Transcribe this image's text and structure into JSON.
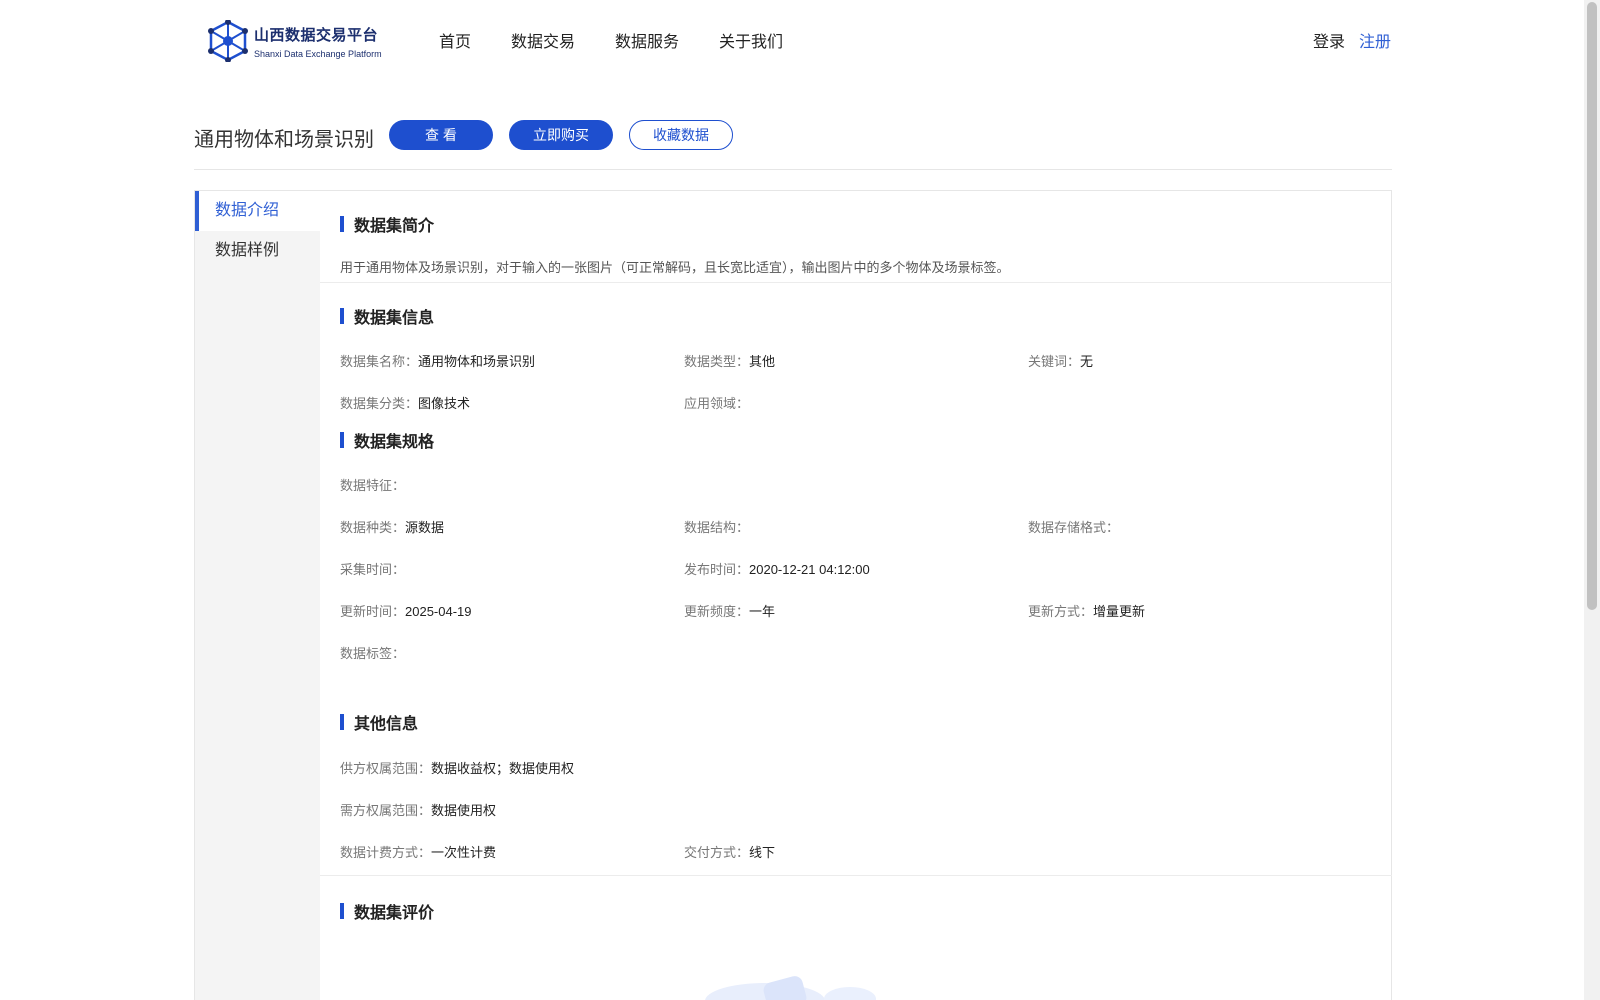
{
  "header": {
    "logo_cn": "山西数据交易平台",
    "logo_en": "Shanxi Data Exchange Platform",
    "nav": [
      "首页",
      "数据交易",
      "数据服务",
      "关于我们"
    ],
    "login": "登录",
    "register": "注册"
  },
  "dataset": {
    "title": "通用物体和场景识别",
    "btn_view": "查 看",
    "btn_buy": "立即购买",
    "btn_fav": "收藏数据"
  },
  "sidebar": {
    "items": [
      {
        "label": "数据介绍",
        "active": true
      },
      {
        "label": "数据样例",
        "active": false
      }
    ]
  },
  "intro": {
    "title": "数据集简介",
    "text": "用于通用物体及场景识别，对于输入的一张图片（可正常解码，且长宽比适宜），输出图片中的多个物体及场景标签。"
  },
  "info": {
    "title": "数据集信息",
    "name_k": "数据集名称：",
    "name_v": "通用物体和场景识别",
    "type_k": "数据类型：",
    "type_v": "其他",
    "kw_k": "关键词：",
    "kw_v": "无",
    "cat_k": "数据集分类：",
    "cat_v": "图像技术",
    "field_k": "应用领域：",
    "field_v": ""
  },
  "spec": {
    "title": "数据集规格",
    "feature_k": "数据特征：",
    "feature_v": "",
    "kind_k": "数据种类：",
    "kind_v": "源数据",
    "struct_k": "数据结构：",
    "struct_v": "",
    "format_k": "数据存储格式：",
    "format_v": "",
    "collect_k": "采集时间：",
    "collect_v": "",
    "publish_k": "发布时间：",
    "publish_v": "2020-12-21 04:12:00",
    "update_k": "更新时间：",
    "update_v": "2025-04-19",
    "freq_k": "更新频度：",
    "freq_v": "一年",
    "mode_k": "更新方式：",
    "mode_v": "增量更新",
    "tags_k": "数据标签：",
    "tags_v": ""
  },
  "other": {
    "title": "其他信息",
    "supply_k": "供方权属范围：",
    "supply_v": "数据收益权；数据使用权",
    "demand_k": "需方权属范围：",
    "demand_v": "数据使用权",
    "billing_k": "数据计费方式：",
    "billing_v": "一次性计费",
    "delivery_k": "交付方式：",
    "delivery_v": "线下"
  },
  "review": {
    "title": "数据集评价"
  },
  "colors": {
    "accent": "#1e4fcf",
    "link": "#2f5fd4",
    "sidebar_bg": "#f4f4f4"
  }
}
